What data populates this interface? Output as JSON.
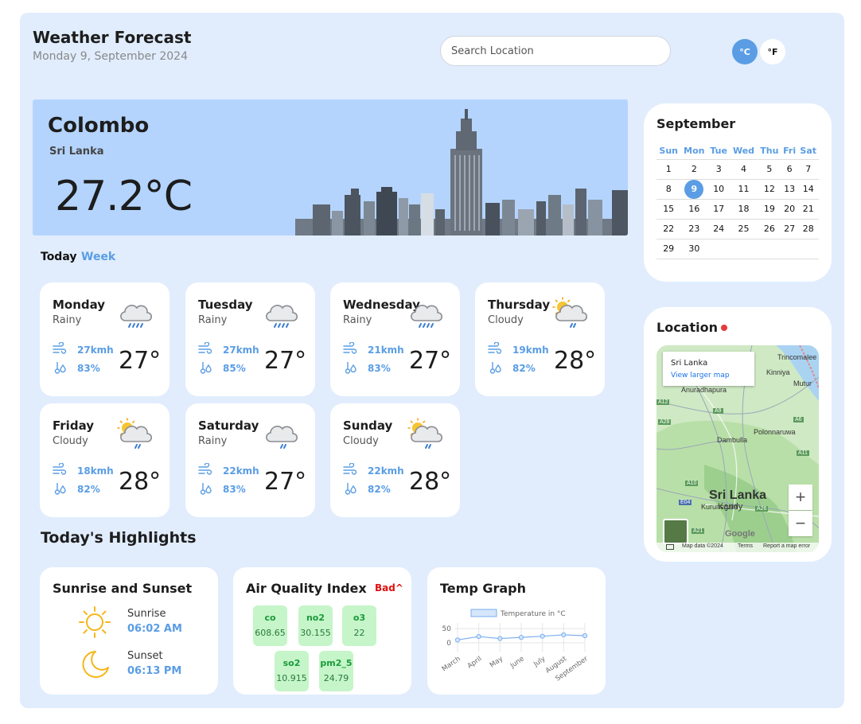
{
  "header": {
    "title": "Weather Forecast",
    "date": "Monday 9, September 2024",
    "search_placeholder": "Search Location",
    "unit_c": "°C",
    "unit_f": "°F"
  },
  "current": {
    "city": "Colombo",
    "country": "Sri Lanka",
    "temperature": "27.2°C"
  },
  "tabs": {
    "today": "Today",
    "week": "Week"
  },
  "days": [
    {
      "name": "Monday",
      "condition": "Rainy",
      "wind": "27kmh",
      "humidity": "83%",
      "temp": "27°",
      "icon": "rain-cloud-icon"
    },
    {
      "name": "Tuesday",
      "condition": "Rainy",
      "wind": "27kmh",
      "humidity": "85%",
      "temp": "27°",
      "icon": "rain-cloud-icon"
    },
    {
      "name": "Wednesday",
      "condition": "Rainy",
      "wind": "21kmh",
      "humidity": "83%",
      "temp": "27°",
      "icon": "rain-cloud-icon"
    },
    {
      "name": "Thursday",
      "condition": "Cloudy",
      "wind": "19kmh",
      "humidity": "82%",
      "temp": "28°",
      "icon": "sun-cloud-rain-icon"
    },
    {
      "name": "Friday",
      "condition": "Cloudy",
      "wind": "18kmh",
      "humidity": "82%",
      "temp": "28°",
      "icon": "sun-cloud-rain-icon"
    },
    {
      "name": "Saturday",
      "condition": "Rainy",
      "wind": "22kmh",
      "humidity": "83%",
      "temp": "27°",
      "icon": "cloud-drizzle-icon"
    },
    {
      "name": "Sunday",
      "condition": "Cloudy",
      "wind": "22kmh",
      "humidity": "82%",
      "temp": "28°",
      "icon": "sun-cloud-rain-icon"
    }
  ],
  "highlights": {
    "title": "Today's Highlights",
    "sun": {
      "title": "Sunrise and Sunset",
      "sunrise_label": "Sunrise",
      "sunrise_time": "06:02 AM",
      "sunset_label": "Sunset",
      "sunset_time": "06:13 PM"
    },
    "aqi": {
      "title": "Air Quality Index",
      "status": "Bad^",
      "items": [
        {
          "name": "co",
          "value": "608.65"
        },
        {
          "name": "no2",
          "value": "30.155"
        },
        {
          "name": "o3",
          "value": "22"
        },
        {
          "name": "so2",
          "value": "10.915"
        },
        {
          "name": "pm2_5",
          "value": "24.79"
        }
      ]
    },
    "graph": {
      "title": "Temp Graph"
    }
  },
  "chart_data": {
    "type": "line",
    "legend": "Temperature in °C",
    "categories": [
      "March",
      "April",
      "May",
      "June",
      "July",
      "August",
      "September"
    ],
    "values": [
      10,
      22,
      15,
      19,
      23,
      28,
      25
    ],
    "yticks": [
      "50",
      "0"
    ],
    "ylim": [
      -20,
      70
    ],
    "legend_position": "top",
    "grid": true,
    "color": "#7aaef0"
  },
  "calendar": {
    "month": "September",
    "weekdays": [
      "Sun",
      "Mon",
      "Tue",
      "Wed",
      "Thu",
      "Fri",
      "Sat"
    ],
    "weeks": [
      [
        "1",
        "2",
        "3",
        "4",
        "5",
        "6",
        "7"
      ],
      [
        "8",
        "9",
        "10",
        "11",
        "12",
        "13",
        "14"
      ],
      [
        "15",
        "16",
        "17",
        "18",
        "19",
        "20",
        "21"
      ],
      [
        "22",
        "23",
        "24",
        "25",
        "26",
        "27",
        "28"
      ],
      [
        "29",
        "30",
        "",
        "",
        "",
        "",
        ""
      ]
    ],
    "today": "9"
  },
  "location": {
    "title": "Location",
    "map": {
      "info_title": "Sri Lanka",
      "info_link": "View larger map",
      "country_label": "Sri Lanka",
      "cities": [
        "Trincomalee",
        "Kinniya",
        "Mutur",
        "Anuradhapura",
        "Dambulla",
        "Polonnaruwa",
        "Kurunegala",
        "Kandy"
      ],
      "roads": [
        "A12",
        "A9",
        "A28",
        "A6",
        "A10",
        "E04",
        "A21",
        "A26",
        "A11"
      ],
      "zoom_in": "+",
      "zoom_out": "−",
      "footer_data": "Map data ©2024",
      "footer_terms": "Terms",
      "footer_report": "Report a map error",
      "brand": "Google"
    }
  },
  "colors": {
    "accent": "#5a9de4",
    "background": "#e1edfd",
    "banner": "#b4d4fd",
    "aqi_box": "#c5f5c9",
    "bad": "#e01010"
  }
}
